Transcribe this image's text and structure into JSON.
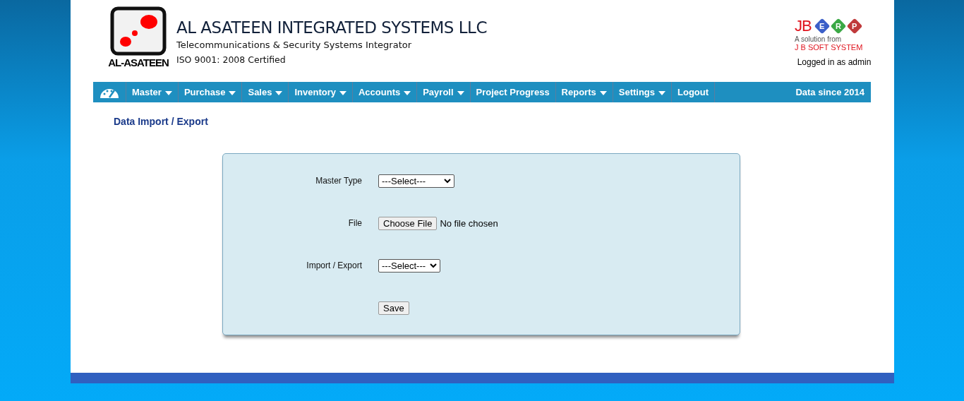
{
  "header": {
    "logo_text": "AL-ASATEEN",
    "company": "AL ASATEEN INTEGRATED SYSTEMS LLC",
    "tagline": "Telecommunications & Security Systems Integrator",
    "certification": "ISO 9001: 2008 Certified",
    "erp_logo": {
      "jb": "JB",
      "letters": [
        "E",
        "R",
        "P"
      ],
      "subtitle": "A solution from",
      "vendor": "J B SOFT SYSTEM"
    },
    "user": "Logged in as admin"
  },
  "menu": [
    {
      "label": "Master",
      "dropdown": true
    },
    {
      "label": "Purchase",
      "dropdown": true
    },
    {
      "label": "Sales",
      "dropdown": true
    },
    {
      "label": "Inventory",
      "dropdown": true
    },
    {
      "label": "Accounts",
      "dropdown": true
    },
    {
      "label": "Payroll",
      "dropdown": true
    },
    {
      "label": "Project Progress",
      "dropdown": false
    },
    {
      "label": "Reports",
      "dropdown": true
    },
    {
      "label": "Settings",
      "dropdown": true
    },
    {
      "label": "Logout",
      "dropdown": false
    }
  ],
  "menu_note": "Data since 2014",
  "page_title": "Data Import / Export",
  "form": [
    {
      "kind": "select",
      "label": "Master Type",
      "value": "---Select---",
      "wide": true
    },
    {
      "kind": "file",
      "label": "File",
      "button": "Choose File",
      "status": "No file chosen"
    },
    {
      "kind": "select",
      "label": "Import / Export",
      "value": "---Select---",
      "wide": false
    },
    {
      "kind": "button",
      "label": "Save"
    }
  ]
}
